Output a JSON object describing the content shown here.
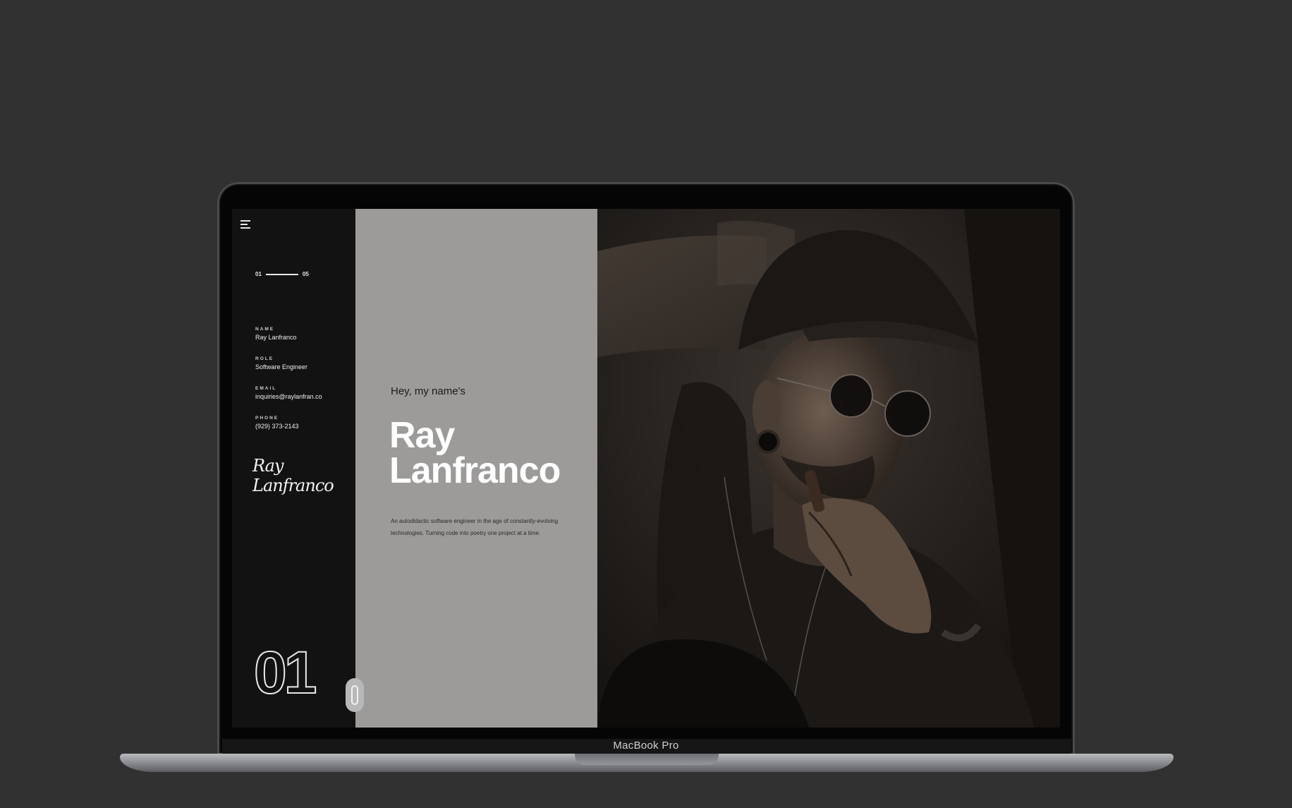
{
  "device": {
    "brand_label": "MacBook Pro"
  },
  "sidebar": {
    "pager": {
      "current": "01",
      "total": "05"
    },
    "info": [
      {
        "label": "NAME",
        "value": "Ray Lanfranco"
      },
      {
        "label": "ROLE",
        "value": "Software Engineer"
      },
      {
        "label": "EMAIL",
        "value": "inquiries@raylanfran.co"
      },
      {
        "label": "PHONE",
        "value": "(929) 373-2143"
      }
    ],
    "signature": "Ray Lanfranco",
    "section_number": "01"
  },
  "hero": {
    "greeting": "Hey, my name's",
    "name_line1": "Ray",
    "name_line2": "Lanfranco",
    "description": "An autodidactic software engineer in the age of constantly-evolving technologies. Turning code into poetry one project at a time."
  },
  "colors": {
    "background": "#313131",
    "sidebar": "#121212",
    "panel": "#9c9b99",
    "text_light": "#ffffff"
  },
  "icons": [
    "menu-icon",
    "scroll-mouse-icon"
  ]
}
